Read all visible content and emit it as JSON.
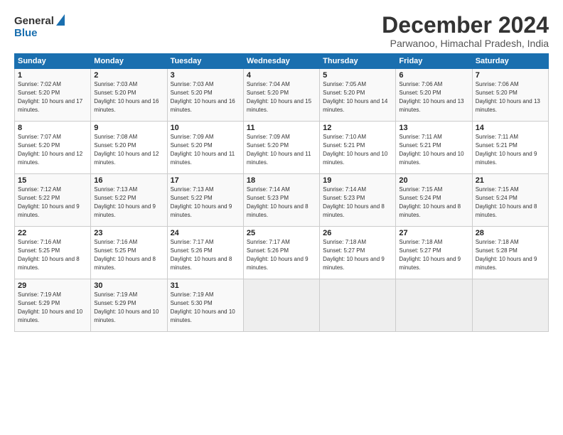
{
  "logo": {
    "line1": "General",
    "line2": "Blue"
  },
  "title": "December 2024",
  "subtitle": "Parwanoo, Himachal Pradesh, India",
  "days_of_week": [
    "Sunday",
    "Monday",
    "Tuesday",
    "Wednesday",
    "Thursday",
    "Friday",
    "Saturday"
  ],
  "weeks": [
    [
      {
        "day": "1",
        "rise": "7:02 AM",
        "set": "5:20 PM",
        "daylight": "10 hours and 17 minutes."
      },
      {
        "day": "2",
        "rise": "7:03 AM",
        "set": "5:20 PM",
        "daylight": "10 hours and 16 minutes."
      },
      {
        "day": "3",
        "rise": "7:03 AM",
        "set": "5:20 PM",
        "daylight": "10 hours and 16 minutes."
      },
      {
        "day": "4",
        "rise": "7:04 AM",
        "set": "5:20 PM",
        "daylight": "10 hours and 15 minutes."
      },
      {
        "day": "5",
        "rise": "7:05 AM",
        "set": "5:20 PM",
        "daylight": "10 hours and 14 minutes."
      },
      {
        "day": "6",
        "rise": "7:06 AM",
        "set": "5:20 PM",
        "daylight": "10 hours and 13 minutes."
      },
      {
        "day": "7",
        "rise": "7:06 AM",
        "set": "5:20 PM",
        "daylight": "10 hours and 13 minutes."
      }
    ],
    [
      {
        "day": "8",
        "rise": "7:07 AM",
        "set": "5:20 PM",
        "daylight": "10 hours and 12 minutes."
      },
      {
        "day": "9",
        "rise": "7:08 AM",
        "set": "5:20 PM",
        "daylight": "10 hours and 12 minutes."
      },
      {
        "day": "10",
        "rise": "7:09 AM",
        "set": "5:20 PM",
        "daylight": "10 hours and 11 minutes."
      },
      {
        "day": "11",
        "rise": "7:09 AM",
        "set": "5:20 PM",
        "daylight": "10 hours and 11 minutes."
      },
      {
        "day": "12",
        "rise": "7:10 AM",
        "set": "5:21 PM",
        "daylight": "10 hours and 10 minutes."
      },
      {
        "day": "13",
        "rise": "7:11 AM",
        "set": "5:21 PM",
        "daylight": "10 hours and 10 minutes."
      },
      {
        "day": "14",
        "rise": "7:11 AM",
        "set": "5:21 PM",
        "daylight": "10 hours and 9 minutes."
      }
    ],
    [
      {
        "day": "15",
        "rise": "7:12 AM",
        "set": "5:22 PM",
        "daylight": "10 hours and 9 minutes."
      },
      {
        "day": "16",
        "rise": "7:13 AM",
        "set": "5:22 PM",
        "daylight": "10 hours and 9 minutes."
      },
      {
        "day": "17",
        "rise": "7:13 AM",
        "set": "5:22 PM",
        "daylight": "10 hours and 9 minutes."
      },
      {
        "day": "18",
        "rise": "7:14 AM",
        "set": "5:23 PM",
        "daylight": "10 hours and 8 minutes."
      },
      {
        "day": "19",
        "rise": "7:14 AM",
        "set": "5:23 PM",
        "daylight": "10 hours and 8 minutes."
      },
      {
        "day": "20",
        "rise": "7:15 AM",
        "set": "5:24 PM",
        "daylight": "10 hours and 8 minutes."
      },
      {
        "day": "21",
        "rise": "7:15 AM",
        "set": "5:24 PM",
        "daylight": "10 hours and 8 minutes."
      }
    ],
    [
      {
        "day": "22",
        "rise": "7:16 AM",
        "set": "5:25 PM",
        "daylight": "10 hours and 8 minutes."
      },
      {
        "day": "23",
        "rise": "7:16 AM",
        "set": "5:25 PM",
        "daylight": "10 hours and 8 minutes."
      },
      {
        "day": "24",
        "rise": "7:17 AM",
        "set": "5:26 PM",
        "daylight": "10 hours and 8 minutes."
      },
      {
        "day": "25",
        "rise": "7:17 AM",
        "set": "5:26 PM",
        "daylight": "10 hours and 9 minutes."
      },
      {
        "day": "26",
        "rise": "7:18 AM",
        "set": "5:27 PM",
        "daylight": "10 hours and 9 minutes."
      },
      {
        "day": "27",
        "rise": "7:18 AM",
        "set": "5:27 PM",
        "daylight": "10 hours and 9 minutes."
      },
      {
        "day": "28",
        "rise": "7:18 AM",
        "set": "5:28 PM",
        "daylight": "10 hours and 9 minutes."
      }
    ],
    [
      {
        "day": "29",
        "rise": "7:19 AM",
        "set": "5:29 PM",
        "daylight": "10 hours and 10 minutes."
      },
      {
        "day": "30",
        "rise": "7:19 AM",
        "set": "5:29 PM",
        "daylight": "10 hours and 10 minutes."
      },
      {
        "day": "31",
        "rise": "7:19 AM",
        "set": "5:30 PM",
        "daylight": "10 hours and 10 minutes."
      },
      null,
      null,
      null,
      null
    ]
  ]
}
